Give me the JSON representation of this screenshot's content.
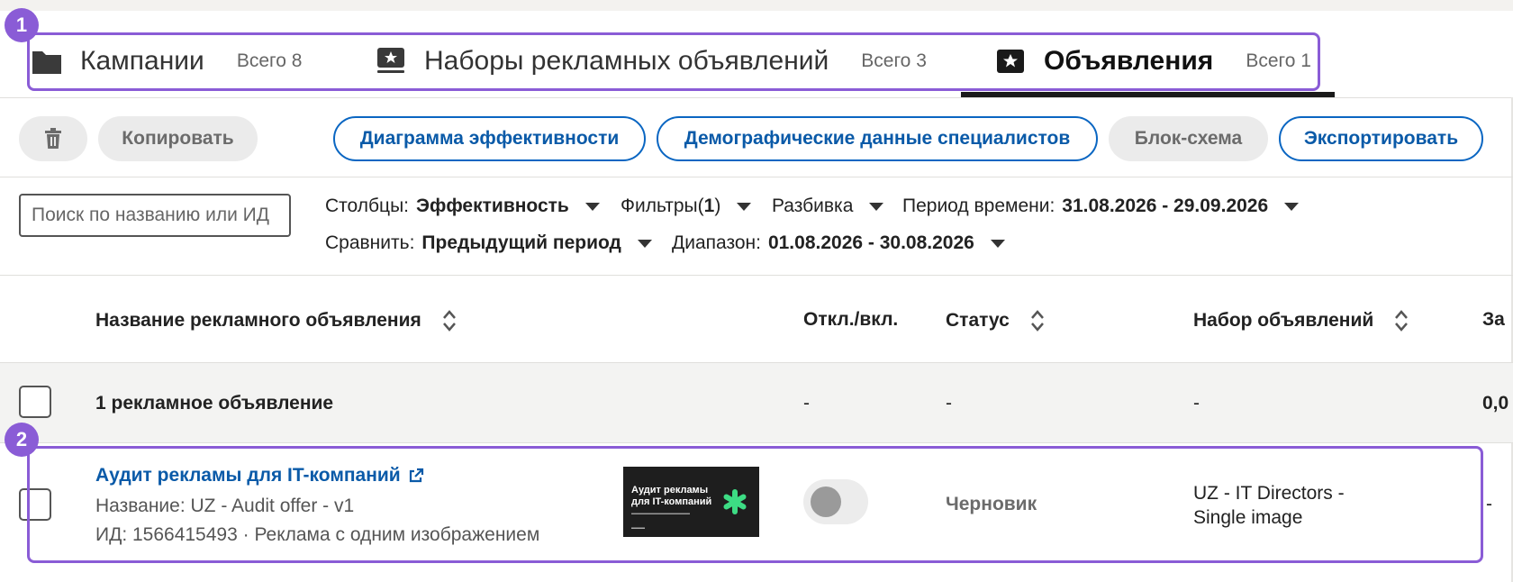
{
  "tabs": [
    {
      "label": "Кампании",
      "count": "Всего 8",
      "icon": "folder-icon",
      "active": false
    },
    {
      "label": "Наборы рекламных объявлений",
      "count": "Всего 3",
      "icon": "ad-set-icon",
      "active": false
    },
    {
      "label": "Объявления",
      "count": "Всего 1",
      "icon": "ad-icon",
      "active": true
    }
  ],
  "toolbar": {
    "copy_label": "Копировать",
    "chart_label": "Диаграмма эффективности",
    "demographics_label": "Демографические данные специалистов",
    "flow_label": "Блок-схема",
    "export_label": "Экспортировать"
  },
  "search": {
    "placeholder": "Поиск по названию или ИД"
  },
  "filters": {
    "columns_label": "Столбцы:",
    "columns_value": "Эффективность",
    "filters_label": "Фильтры(",
    "filters_count": "1",
    "filters_close": ")",
    "breakdown_label": "Разбивка",
    "period_label": "Период времени:",
    "period_value": "31.08.2026 - 29.09.2026",
    "compare_label": "Сравнить:",
    "compare_value": "Предыдущий период",
    "range_label": "Диапазон:",
    "range_value": "01.08.2026 - 30.08.2026"
  },
  "table": {
    "headers": {
      "name": "Название рекламного объявления",
      "toggle": "Откл./вкл.",
      "status": "Статус",
      "adset": "Набор объявлений",
      "next": "За"
    },
    "summary": {
      "name": "1 рекламное объявление",
      "toggle": "-",
      "status": "-",
      "adset": "-",
      "next": "0,0"
    },
    "rows": [
      {
        "title": "Аудит рекламы для IT-компаний",
        "name_line": "Название: UZ - Audit offer - v1",
        "id_line": "ИД: 1566415493 · Реклама с одним изображением",
        "thumb_title": "Аудит рекламы для IT-компаний",
        "toggle_on": false,
        "status": "Черновик",
        "adset": "UZ - IT Directors - Single image",
        "next": "-"
      }
    ]
  },
  "annotations": {
    "badge1": "1",
    "badge2": "2"
  },
  "colors": {
    "accent": "#0a66c2",
    "annotation": "#8a5cd6",
    "thumb_star": "#3ddc84"
  }
}
